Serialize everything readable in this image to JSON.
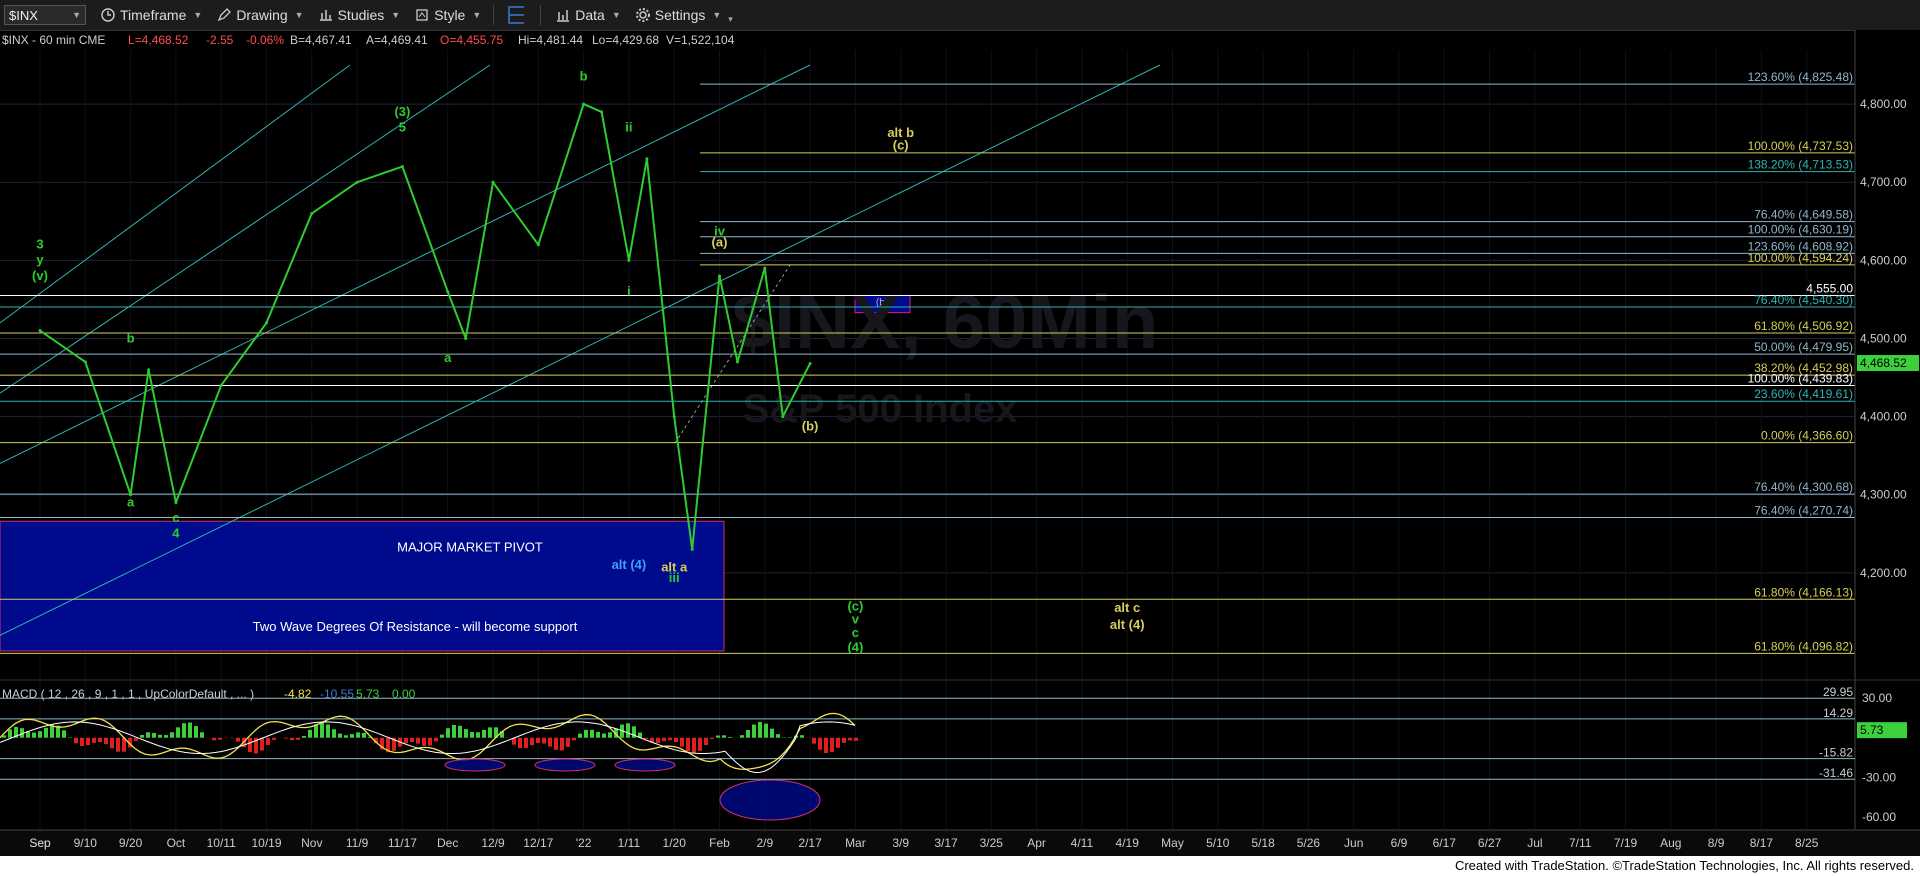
{
  "toolbar": {
    "symbol": "$INX",
    "timeframe": "Timeframe",
    "drawing": "Drawing",
    "studies": "Studies",
    "style": "Style",
    "data": "Data",
    "settings": "Settings"
  },
  "header": {
    "symbol_info": "$INX - 60 min  CME",
    "last": "L=4,468.52",
    "change": "-2.55",
    "change_pct": "-0.06%",
    "bid": "B=4,467.41",
    "ask": "A=4,469.41",
    "open": "O=4,455.75",
    "high": "Hi=4,481.44",
    "low": "Lo=4,429.68",
    "volume": "V=1,522,104"
  },
  "watermark": {
    "line1": "$INX, 60Min",
    "line2": "S&P 500 Index"
  },
  "colors": {
    "bg": "#000000",
    "price": "#2ecc2e",
    "grid": "#23233a",
    "fib_blue": "#8fb7cc",
    "fib_yellow": "#d6cf5a",
    "teal": "#2fb3b3",
    "pivot": "#000a8c",
    "macd_pos": "#3cd13c",
    "macd_neg": "#e02020"
  },
  "chart_data": {
    "type": "line",
    "title": "$INX, 60Min",
    "subtitle": "S&P 500 Index",
    "ylim": [
      4050,
      4850
    ],
    "y_ticks": [
      4200,
      4300,
      4400,
      4500,
      4600,
      4700,
      4800
    ],
    "y_tick_labels": [
      "4,200.00",
      "4,300.00",
      "4,400.00",
      "4,500.00",
      "4,600.00",
      "4,700.00",
      "4,800.00"
    ],
    "last_price_label": "4,468.52",
    "x_axis_labels": [
      "Sep",
      "9/10",
      "9/20",
      "Oct",
      "10/11",
      "10/19",
      "Nov",
      "11/9",
      "11/17",
      "Dec",
      "12/9",
      "12/17",
      "'22",
      "1/11",
      "1/20",
      "Feb",
      "2/9",
      "2/17",
      "Mar",
      "3/9",
      "3/17",
      "3/25",
      "Apr",
      "4/11",
      "4/19",
      "May",
      "5/10",
      "5/18",
      "5/26",
      "Jun",
      "6/9",
      "6/17",
      "6/27",
      "Jul",
      "7/11",
      "7/19",
      "Aug",
      "8/9",
      "8/17",
      "8/25",
      "Sep"
    ],
    "price_series": {
      "name": "$INX",
      "points": [
        [
          "Sep",
          4510
        ],
        [
          "9/10",
          4470
        ],
        [
          "9/20",
          4300
        ],
        [
          "9/20",
          4460
        ],
        [
          "Oct",
          4290
        ],
        [
          "10/11",
          4440
        ],
        [
          "10/19",
          4520
        ],
        [
          "Nov",
          4660
        ],
        [
          "11/9",
          4700
        ],
        [
          "11/17",
          4720
        ],
        [
          "Dec",
          4560
        ],
        [
          "Dec",
          4500
        ],
        [
          "12/9",
          4700
        ],
        [
          "12/17",
          4620
        ],
        [
          "'22",
          4800
        ],
        [
          "'22",
          4790
        ],
        [
          "1/11",
          4600
        ],
        [
          "1/11",
          4730
        ],
        [
          "1/20",
          4400
        ],
        [
          "1/20",
          4230
        ],
        [
          "Feb",
          4580
        ],
        [
          "Feb",
          4470
        ],
        [
          "2/9",
          4590
        ],
        [
          "2/9",
          4400
        ],
        [
          "2/17",
          4468
        ]
      ]
    },
    "fib_levels": [
      {
        "label": "123.60% (4,825.48)",
        "value": 4825.48,
        "color": "#8fb7cc"
      },
      {
        "label": "100.00% (4,737.53)",
        "value": 4737.53,
        "color": "#d6cf5a"
      },
      {
        "label": "138.20% (4,713.53)",
        "value": 4713.53,
        "color": "#2fb3b3"
      },
      {
        "label": "76.40% (4,649.58)",
        "value": 4649.58,
        "color": "#8fb7cc"
      },
      {
        "label": "100.00% (4,630.19)",
        "value": 4630.19,
        "color": "#8fb7cc"
      },
      {
        "label": "123.60% (4,608.92)",
        "value": 4608.92,
        "color": "#8fb7cc"
      },
      {
        "label": "100.00% (4,594.24)",
        "value": 4594.24,
        "color": "#d6cf5a"
      },
      {
        "label": "4,555.00",
        "value": 4555.0,
        "color": "#ffffff"
      },
      {
        "label": "76.40% (4,540.30)",
        "value": 4540.3,
        "color": "#2fb3b3"
      },
      {
        "label": "61.80% (4,506.92)",
        "value": 4506.92,
        "color": "#d6cf5a"
      },
      {
        "label": "50.00% (4,479.95)",
        "value": 4479.95,
        "color": "#8fb7cc"
      },
      {
        "label": "38.20% (4,452.98)",
        "value": 4452.98,
        "color": "#d6cf5a"
      },
      {
        "label": "100.00% (4,439.83)",
        "value": 4439.83,
        "color": "#ffffff"
      },
      {
        "label": "23.60% (4,419.61)",
        "value": 4419.61,
        "color": "#2fb3b3"
      },
      {
        "label": "0.00% (4,366.60)",
        "value": 4366.6,
        "color": "#d6cf5a"
      },
      {
        "label": "76.40% (4,300.68)",
        "value": 4300.68,
        "color": "#8fb7cc"
      },
      {
        "label": "76.40% (4,270.74)",
        "value": 4270.74,
        "color": "#8fb7cc"
      },
      {
        "label": "61.80% (4,166.13)",
        "value": 4166.13,
        "color": "#d6cf5a"
      },
      {
        "label": "61.80% (4,096.82)",
        "value": 4096.82,
        "color": "#d6cf5a"
      }
    ],
    "pivot_box": {
      "label": "MAJOR MARKET PIVOT",
      "sublabel": "Two Wave Degrees Of Resistance - will become support",
      "top": 4266,
      "bottom": 4100
    },
    "b_box_label": "(b)",
    "wave_labels": [
      {
        "text": "b",
        "x": "'22",
        "y": 4830,
        "color": "#2ecc2e"
      },
      {
        "text": "(3)",
        "x": "11/17",
        "y": 4785,
        "color": "#2ecc2e"
      },
      {
        "text": "5",
        "x": "11/17",
        "y": 4765,
        "color": "#2ecc2e"
      },
      {
        "text": "ii",
        "x": "1/11",
        "y": 4765,
        "color": "#2ecc2e"
      },
      {
        "text": "3",
        "x": "Sep",
        "y": 4615,
        "color": "#2ecc2e"
      },
      {
        "text": "y",
        "x": "Sep",
        "y": 4595,
        "color": "#2ecc2e"
      },
      {
        "text": "(v)",
        "x": "Sep",
        "y": 4575,
        "color": "#2ecc2e"
      },
      {
        "text": "b",
        "x": "9/20",
        "y": 4495,
        "color": "#2ecc2e"
      },
      {
        "text": "a",
        "x": "Dec",
        "y": 4470,
        "color": "#2ecc2e"
      },
      {
        "text": "a",
        "x": "9/20",
        "y": 4285,
        "color": "#2ecc2e"
      },
      {
        "text": "c",
        "x": "Oct",
        "y": 4265,
        "color": "#2ecc2e"
      },
      {
        "text": "4",
        "x": "Oct",
        "y": 4245,
        "color": "#2ecc2e"
      },
      {
        "text": "iv",
        "x": "Feb",
        "y": 4632,
        "color": "#2ecc2e"
      },
      {
        "text": "(a)",
        "x": "Feb",
        "y": 4618,
        "color": "#d6cf5a"
      },
      {
        "text": "i",
        "x": "1/11",
        "y": 4555,
        "color": "#2ecc2e"
      },
      {
        "text": "iii",
        "x": "1/20",
        "y": 4188,
        "color": "#2ecc2e"
      },
      {
        "text": "alt a",
        "x": "1/20",
        "y": 4202,
        "color": "#d6cf5a"
      },
      {
        "text": "alt (4)",
        "x": "1/11",
        "y": 4205,
        "color": "#3aa0ff"
      },
      {
        "text": "(b)",
        "x": "2/17",
        "y": 4382,
        "color": "#d6cf5a"
      },
      {
        "text": "alt b",
        "x": "3/9",
        "y": 4758,
        "color": "#d6cf5a"
      },
      {
        "text": "(c)",
        "x": "3/9",
        "y": 4742,
        "color": "#d6cf5a"
      },
      {
        "text": "alt c",
        "x": "4/19",
        "y": 4150,
        "color": "#d6cf5a"
      },
      {
        "text": "alt (4)",
        "x": "4/19",
        "y": 4128,
        "color": "#d6cf5a"
      },
      {
        "text": "(c)",
        "x": "Mar",
        "y": 4152,
        "color": "#2ecc2e"
      },
      {
        "text": "v",
        "x": "Mar",
        "y": 4135,
        "color": "#2ecc2e"
      },
      {
        "text": "c",
        "x": "Mar",
        "y": 4118,
        "color": "#2ecc2e"
      },
      {
        "text": "(4)",
        "x": "Mar",
        "y": 4099,
        "color": "#2ecc2e"
      }
    ],
    "macd": {
      "title": "MACD ( 12 , 26 , 9 , 1 , 1 , UpColorDefault , ... )",
      "values": [
        "-4.82",
        "-10.55",
        "5.73",
        "0.00"
      ],
      "ylim": [
        -70,
        40
      ],
      "y_ticks": [
        30,
        -30,
        -60
      ],
      "y_tick_labels": [
        "30.00",
        "-30.00",
        "-60.00"
      ],
      "levels": [
        {
          "label": "29.95",
          "value": 29.95
        },
        {
          "label": "14.29",
          "value": 14.29
        },
        {
          "label": "-15.82",
          "value": -15.82
        },
        {
          "label": "-31.46",
          "value": -31.46
        }
      ],
      "last_label": "5.73"
    }
  },
  "footer": {
    "credit": "Created with TradeStation. ©TradeStation Technologies, Inc. All rights reserved."
  }
}
